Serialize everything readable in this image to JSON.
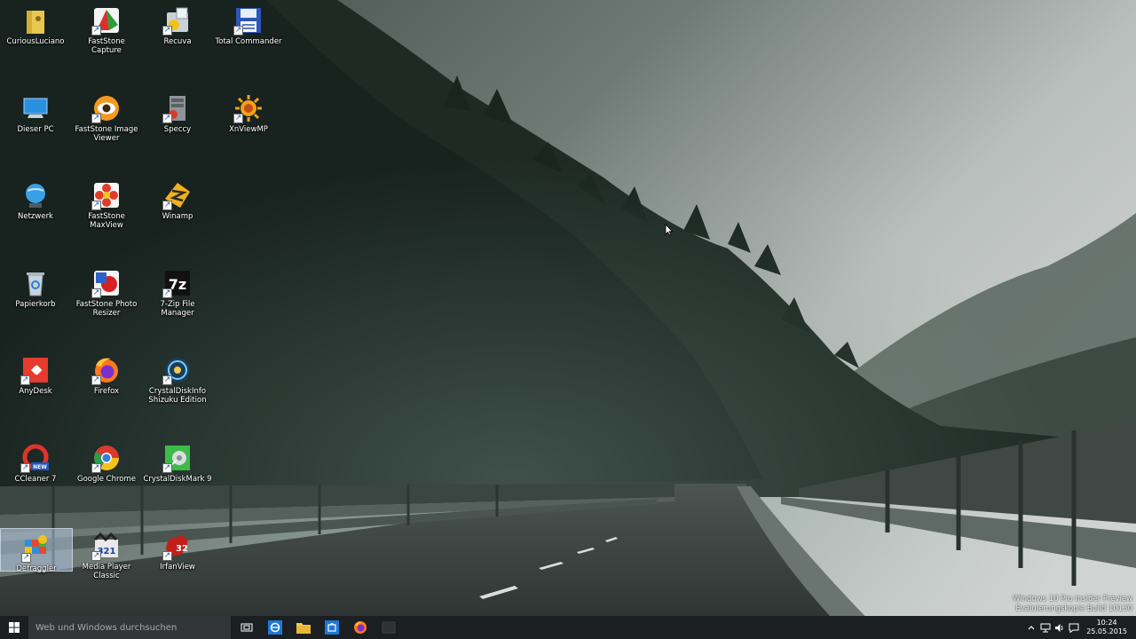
{
  "desktop_icons": [
    {
      "label": "CuriousLuciano",
      "icon": "folder-user-icon"
    },
    {
      "label": "FastStone Capture",
      "icon": "faststone-capture-icon"
    },
    {
      "label": "Recuva",
      "icon": "recuva-icon"
    },
    {
      "label": "Total Commander",
      "icon": "floppy-disk-icon"
    },
    {
      "label": "Dieser PC",
      "icon": "computer-icon"
    },
    {
      "label": "FastStone Image Viewer",
      "icon": "eye-icon"
    },
    {
      "label": "Speccy",
      "icon": "speccy-icon"
    },
    {
      "label": "XnViewMP",
      "icon": "xnview-icon"
    },
    {
      "label": "Netzwerk",
      "icon": "network-globe-icon"
    },
    {
      "label": "FastStone MaxView",
      "icon": "flower-icon"
    },
    {
      "label": "Winamp",
      "icon": "winamp-icon"
    },
    {
      "label": "Papierkorb",
      "icon": "recycle-bin-icon"
    },
    {
      "label": "FastStone Photo Resizer",
      "icon": "photo-resizer-icon"
    },
    {
      "label": "7-Zip File Manager",
      "icon": "7zip-icon"
    },
    {
      "label": "AnyDesk",
      "icon": "anydesk-icon"
    },
    {
      "label": "Firefox",
      "icon": "firefox-icon"
    },
    {
      "label": "CrystalDiskInfo Shizuku Edition",
      "icon": "crystaldiskinfo-icon"
    },
    {
      "label": "CCleaner 7",
      "icon": "ccleaner-icon"
    },
    {
      "label": "Google Chrome",
      "icon": "chrome-icon"
    },
    {
      "label": "CrystalDiskMark 9",
      "icon": "crystaldiskmark-icon"
    },
    {
      "label": "Defraggler",
      "icon": "defraggler-icon"
    },
    {
      "label": "Media Player Classic",
      "icon": "media-player-classic-icon"
    },
    {
      "label": "IrfanView",
      "icon": "irfanview-icon"
    }
  ],
  "watermark": {
    "line1": "Windows 10 Pro Insider Preview",
    "line2": "Evaluierungskopie Build 10130"
  },
  "taskbar": {
    "search_placeholder": "Web und Windows durchsuchen",
    "pinned": [
      "task-view-icon",
      "internet-explorer-icon",
      "file-explorer-icon",
      "store-icon",
      "firefox-icon",
      "blank-app-icon"
    ],
    "clock_time": "10:24",
    "clock_date": "25.05.2015"
  },
  "colors": {
    "taskbar": "#1c1f22",
    "search_box": "#333639",
    "selection": "#b4c8e1"
  }
}
